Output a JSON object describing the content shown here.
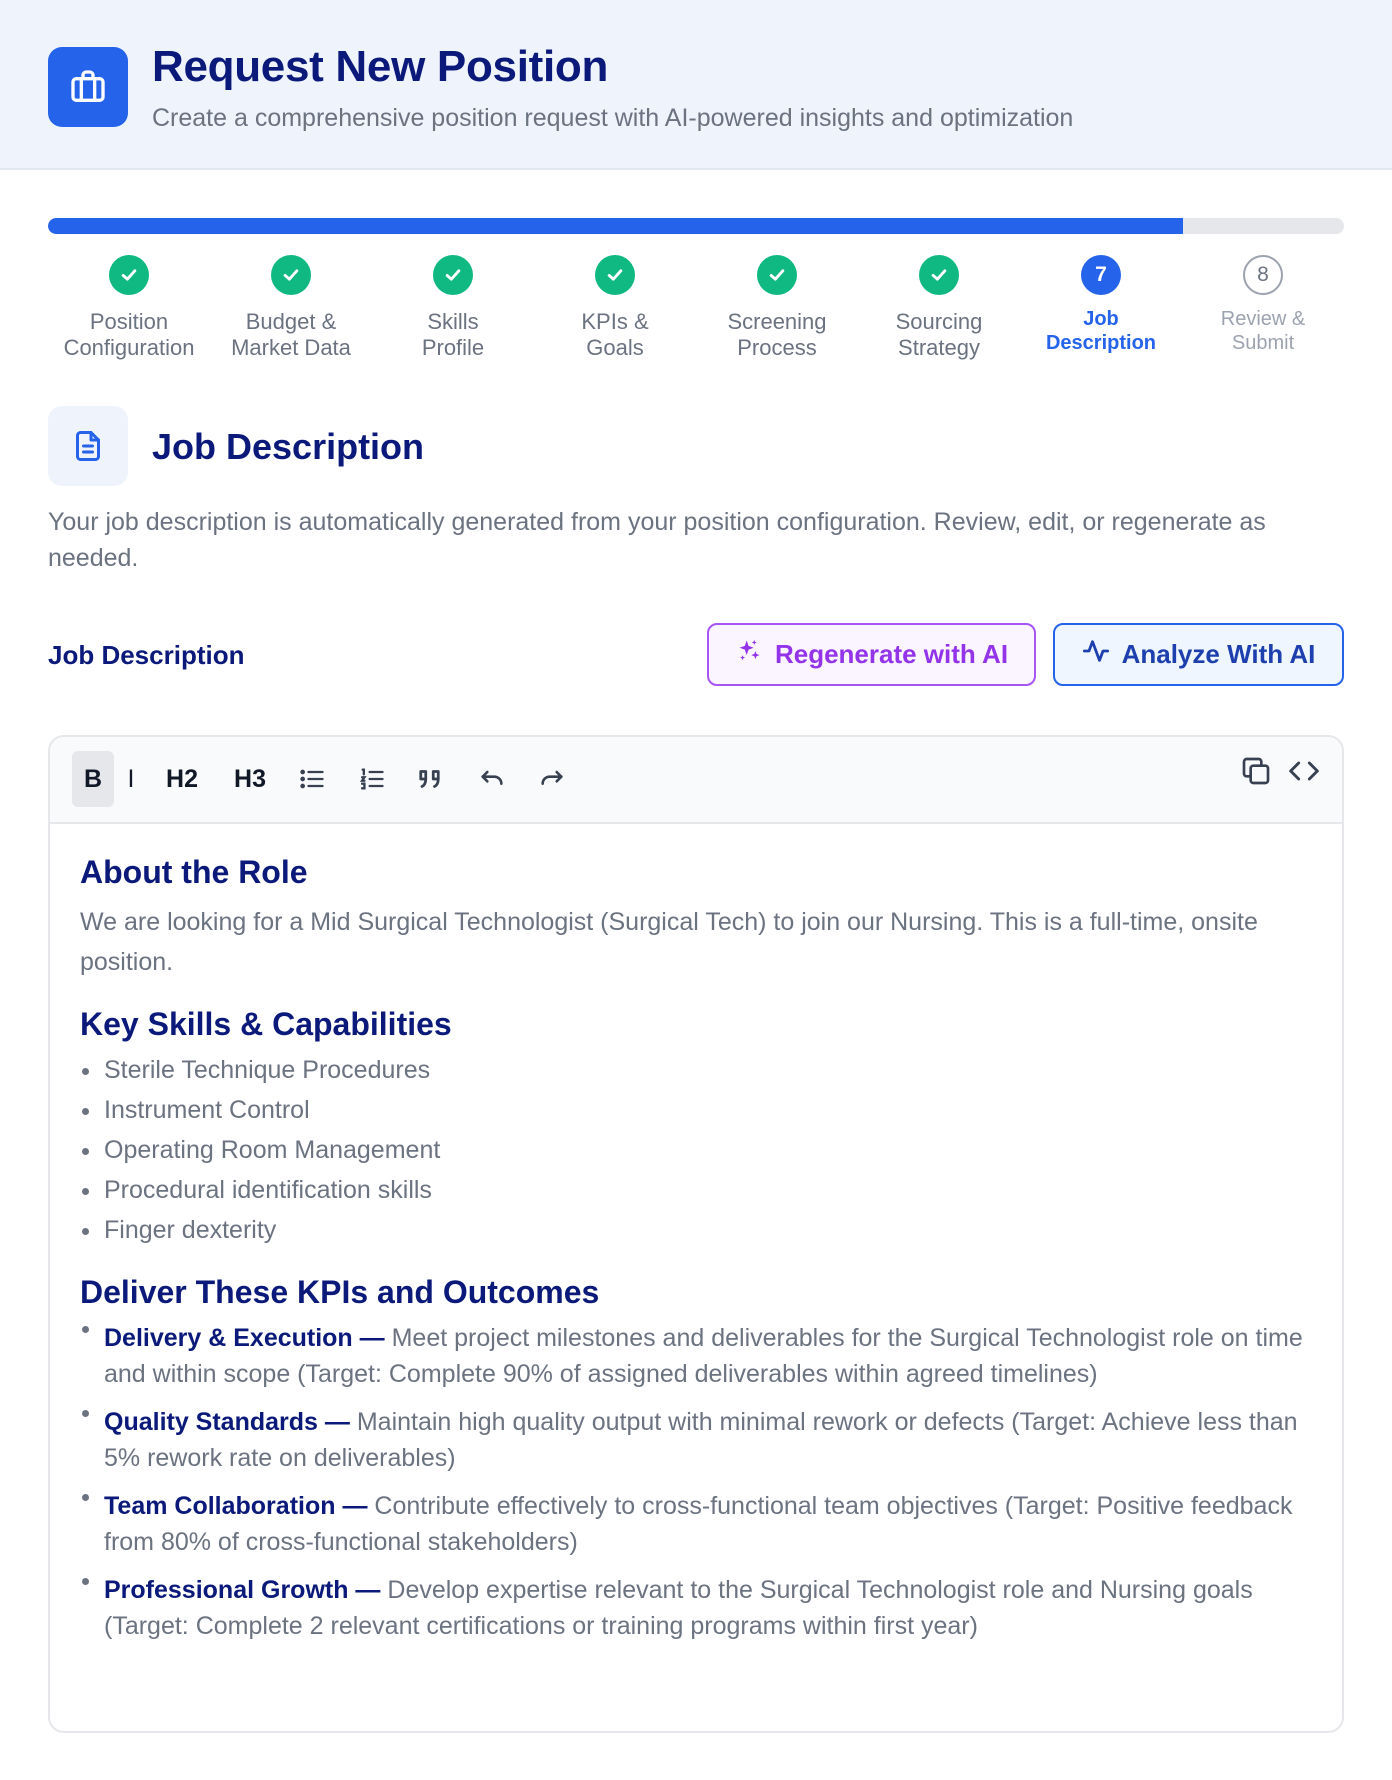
{
  "header": {
    "title": "Request New Position",
    "subtitle": "Create a comprehensive position request with AI-powered insights and optimization",
    "icon": "briefcase-icon"
  },
  "progress": {
    "completed_fraction": 0.876
  },
  "steps": [
    {
      "label": "Position\nConfiguration",
      "state": "done"
    },
    {
      "label": "Budget &\nMarket Data",
      "state": "done"
    },
    {
      "label": "Skills\nProfile",
      "state": "done"
    },
    {
      "label": "KPIs &\nGoals",
      "state": "done"
    },
    {
      "label": "Screening\nProcess",
      "state": "done"
    },
    {
      "label": "Sourcing\nStrategy",
      "state": "done"
    },
    {
      "label": "Job\nDescription",
      "state": "current",
      "number": "7"
    },
    {
      "label": "Review &\nSubmit",
      "state": "pending",
      "number": "8"
    }
  ],
  "section": {
    "title": "Job Description",
    "description": "Your job description is automatically generated from your position configuration. Review, edit, or regenerate as needed.",
    "icon": "document-icon"
  },
  "field": {
    "label": "Job Description",
    "regenerate_label": "Regenerate with AI",
    "analyze_label": "Analyze With AI"
  },
  "toolbar": {
    "bold": "B",
    "italic": "I",
    "h2": "H2",
    "h3": "H3"
  },
  "document": {
    "about_heading": "About the Role",
    "about_text": "We are looking for a Mid Surgical Technologist (Surgical Tech) to join our Nursing. This is a full-time, onsite position.",
    "skills_heading": "Key Skills & Capabilities",
    "skills": [
      "Sterile Technique Procedures",
      "Instrument Control",
      "Operating Room Management",
      "Procedural identification skills",
      "Finger dexterity"
    ],
    "kpis_heading": "Deliver These KPIs and Outcomes",
    "kpis": [
      {
        "name": "Delivery & Execution —",
        "text": " Meet project milestones and deliverables for the Surgical Technologist role on time and within scope (Target: Complete 90% of assigned deliverables within agreed timelines)"
      },
      {
        "name": "Quality Standards —",
        "text": " Maintain high quality output with minimal rework or defects (Target: Achieve less than 5% rework rate on deliverables)"
      },
      {
        "name": "Team Collaboration —",
        "text": " Contribute effectively to cross-functional team objectives (Target: Positive feedback from 80% of cross-functional stakeholders)"
      },
      {
        "name": "Professional Growth —",
        "text": " Develop expertise relevant to the Surgical Technologist role and Nursing goals (Target: Complete 2 relevant certifications or training programs within first year)"
      }
    ]
  },
  "colors": {
    "primary": "#2563eb",
    "success": "#10b981",
    "heading": "#0b1a7a",
    "ai_purple": "#9333ea"
  }
}
